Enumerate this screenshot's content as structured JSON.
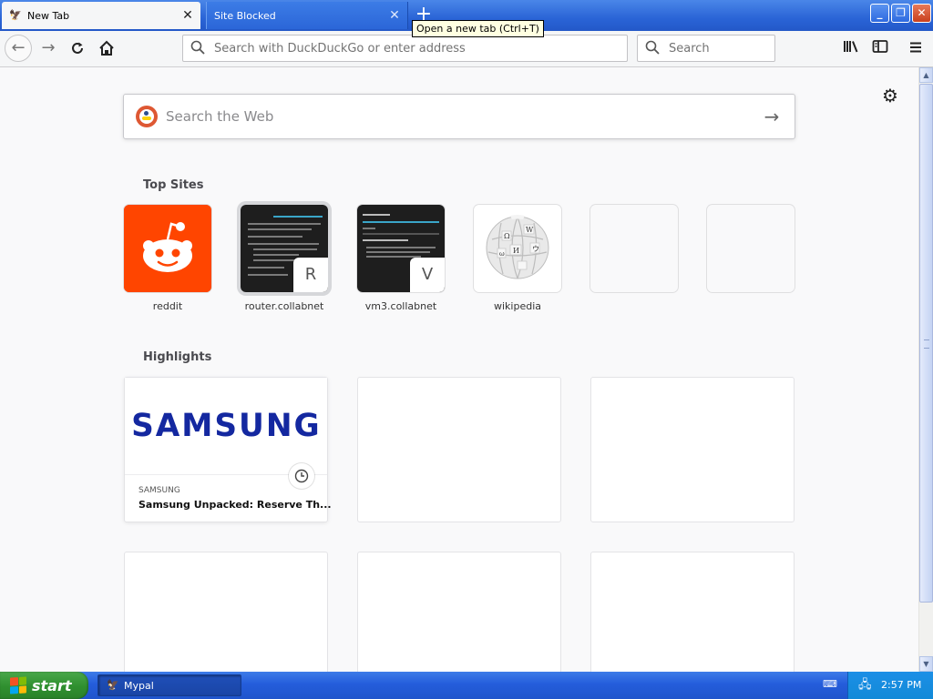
{
  "browser": {
    "tabs": [
      {
        "label": "New Tab",
        "active": true,
        "icon": "mypal-icon"
      },
      {
        "label": "Site Blocked",
        "active": false
      }
    ],
    "new_tab_tooltip": "Open a new tab (Ctrl+T)",
    "url_placeholder": "Search with DuckDuckGo or enter address",
    "search_placeholder": "Search"
  },
  "newtab": {
    "web_search_placeholder": "Search the Web",
    "top_sites_title": "Top Sites",
    "top_sites": [
      {
        "label": "reddit",
        "icon": "reddit-logo"
      },
      {
        "label": "router.collabnet",
        "badge": "R"
      },
      {
        "label": "vm3.collabnet",
        "badge": "V"
      },
      {
        "label": "wikipedia",
        "icon": "wikipedia-globe"
      }
    ],
    "highlights_title": "Highlights",
    "highlight": {
      "logo_text": "SAMSUNG",
      "source": "SAMSUNG",
      "title": "Samsung Unpacked: Reserve Th..."
    }
  },
  "taskbar": {
    "start_label": "start",
    "app_label": "Mypal",
    "clock": "2:57 PM"
  },
  "colors": {
    "reddit": "#ff4500",
    "samsung": "#1428a0",
    "xp_blue": "#245ddb",
    "start_green": "#2f8f2f"
  }
}
